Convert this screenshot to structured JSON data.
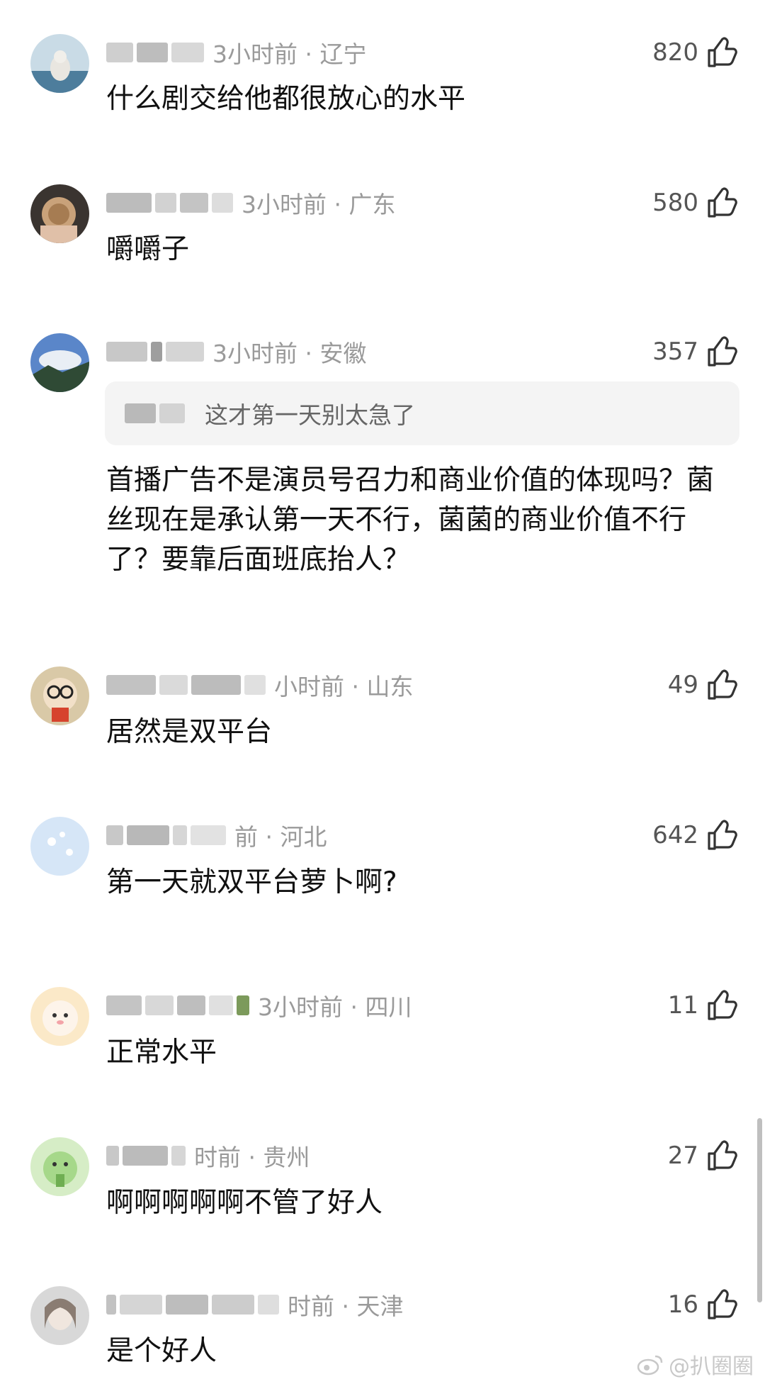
{
  "comments": [
    {
      "meta": "3小时前 · 辽宁",
      "likes": "820",
      "text": "什么剧交给他都很放心的水平",
      "avatar": "avatar-seaside-dog"
    },
    {
      "meta": "3小时前 · 广东",
      "likes": "580",
      "text": "嚼嚼子",
      "avatar": "avatar-bread-face"
    },
    {
      "meta": "3小时前 · 安徽",
      "likes": "357",
      "quote": "这才第一天别太急了",
      "text": "首播广告不是演员号召力和商业价值的体现吗？菌丝现在是承认第一天不行，菌菌的商业价值不行了？要靠后面班底抬人？",
      "avatar": "avatar-mountain-sky"
    },
    {
      "meta": "小时前 · 山东",
      "likes": "49",
      "text": "居然是双平台",
      "avatar": "avatar-cartoon-glasses"
    },
    {
      "meta": "前 · 河北",
      "likes": "642",
      "text": "第一天就双平台萝卜啊?",
      "avatar": "avatar-light-blue"
    },
    {
      "meta": "3小时前 · 四川",
      "likes": "11",
      "text": "正常水平",
      "avatar": "avatar-pink-cat"
    },
    {
      "meta": "时前 · 贵州",
      "likes": "27",
      "text": "啊啊啊啊啊不管了好人",
      "avatar": "avatar-green-frog"
    },
    {
      "meta": "时前 · 天津",
      "likes": "16",
      "text": "是个好人",
      "avatar": "avatar-woman-portrait"
    }
  ],
  "watermark": "@扒圈圈",
  "colors": {
    "meta": "#9a9a9a",
    "quote_bg": "#f4f4f4",
    "text": "#111111"
  }
}
